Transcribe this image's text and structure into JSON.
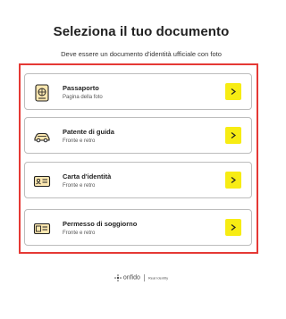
{
  "header": {
    "title": "Seleziona il tuo documento",
    "subtitle": "Deve essere un documento d'identità ufficiale con foto"
  },
  "documents": [
    {
      "label": "Passaporto",
      "sublabel": "Pagina della foto",
      "icon": "passport-icon"
    },
    {
      "label": "Patente di guida",
      "sublabel": "Fronte e retro",
      "icon": "car-icon"
    },
    {
      "label": "Carta d'identità",
      "sublabel": "Fronte e retro",
      "icon": "id-card-icon"
    },
    {
      "label": "Permesso di soggiorno",
      "sublabel": "Fronte e retro",
      "icon": "residence-permit-icon"
    }
  ],
  "footer": {
    "brand": "onfido",
    "tagline": "Real Identity"
  },
  "colors": {
    "accent_button": "#f7ec13",
    "highlight_frame": "#e53935",
    "card_border": "#bdbdbd"
  }
}
